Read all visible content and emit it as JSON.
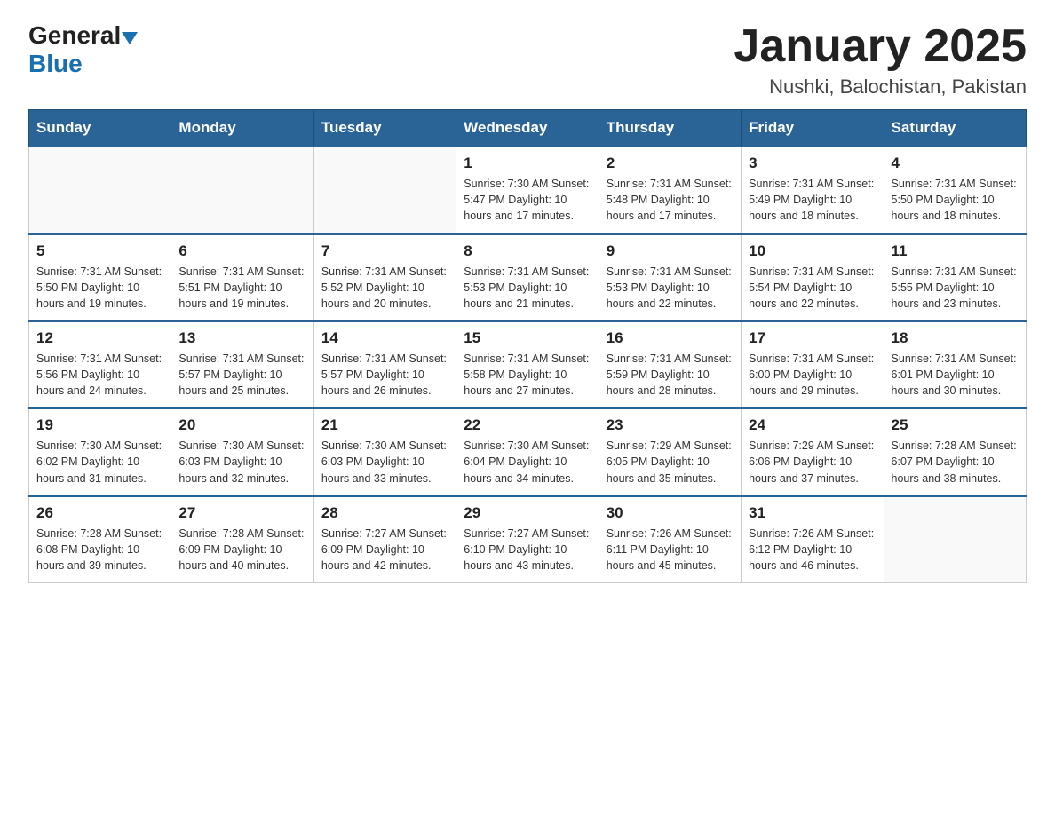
{
  "header": {
    "logo_general": "General",
    "logo_blue": "Blue",
    "title": "January 2025",
    "subtitle": "Nushki, Balochistan, Pakistan"
  },
  "weekdays": [
    "Sunday",
    "Monday",
    "Tuesday",
    "Wednesday",
    "Thursday",
    "Friday",
    "Saturday"
  ],
  "weeks": [
    [
      {
        "day": "",
        "info": ""
      },
      {
        "day": "",
        "info": ""
      },
      {
        "day": "",
        "info": ""
      },
      {
        "day": "1",
        "info": "Sunrise: 7:30 AM\nSunset: 5:47 PM\nDaylight: 10 hours\nand 17 minutes."
      },
      {
        "day": "2",
        "info": "Sunrise: 7:31 AM\nSunset: 5:48 PM\nDaylight: 10 hours\nand 17 minutes."
      },
      {
        "day": "3",
        "info": "Sunrise: 7:31 AM\nSunset: 5:49 PM\nDaylight: 10 hours\nand 18 minutes."
      },
      {
        "day": "4",
        "info": "Sunrise: 7:31 AM\nSunset: 5:50 PM\nDaylight: 10 hours\nand 18 minutes."
      }
    ],
    [
      {
        "day": "5",
        "info": "Sunrise: 7:31 AM\nSunset: 5:50 PM\nDaylight: 10 hours\nand 19 minutes."
      },
      {
        "day": "6",
        "info": "Sunrise: 7:31 AM\nSunset: 5:51 PM\nDaylight: 10 hours\nand 19 minutes."
      },
      {
        "day": "7",
        "info": "Sunrise: 7:31 AM\nSunset: 5:52 PM\nDaylight: 10 hours\nand 20 minutes."
      },
      {
        "day": "8",
        "info": "Sunrise: 7:31 AM\nSunset: 5:53 PM\nDaylight: 10 hours\nand 21 minutes."
      },
      {
        "day": "9",
        "info": "Sunrise: 7:31 AM\nSunset: 5:53 PM\nDaylight: 10 hours\nand 22 minutes."
      },
      {
        "day": "10",
        "info": "Sunrise: 7:31 AM\nSunset: 5:54 PM\nDaylight: 10 hours\nand 22 minutes."
      },
      {
        "day": "11",
        "info": "Sunrise: 7:31 AM\nSunset: 5:55 PM\nDaylight: 10 hours\nand 23 minutes."
      }
    ],
    [
      {
        "day": "12",
        "info": "Sunrise: 7:31 AM\nSunset: 5:56 PM\nDaylight: 10 hours\nand 24 minutes."
      },
      {
        "day": "13",
        "info": "Sunrise: 7:31 AM\nSunset: 5:57 PM\nDaylight: 10 hours\nand 25 minutes."
      },
      {
        "day": "14",
        "info": "Sunrise: 7:31 AM\nSunset: 5:57 PM\nDaylight: 10 hours\nand 26 minutes."
      },
      {
        "day": "15",
        "info": "Sunrise: 7:31 AM\nSunset: 5:58 PM\nDaylight: 10 hours\nand 27 minutes."
      },
      {
        "day": "16",
        "info": "Sunrise: 7:31 AM\nSunset: 5:59 PM\nDaylight: 10 hours\nand 28 minutes."
      },
      {
        "day": "17",
        "info": "Sunrise: 7:31 AM\nSunset: 6:00 PM\nDaylight: 10 hours\nand 29 minutes."
      },
      {
        "day": "18",
        "info": "Sunrise: 7:31 AM\nSunset: 6:01 PM\nDaylight: 10 hours\nand 30 minutes."
      }
    ],
    [
      {
        "day": "19",
        "info": "Sunrise: 7:30 AM\nSunset: 6:02 PM\nDaylight: 10 hours\nand 31 minutes."
      },
      {
        "day": "20",
        "info": "Sunrise: 7:30 AM\nSunset: 6:03 PM\nDaylight: 10 hours\nand 32 minutes."
      },
      {
        "day": "21",
        "info": "Sunrise: 7:30 AM\nSunset: 6:03 PM\nDaylight: 10 hours\nand 33 minutes."
      },
      {
        "day": "22",
        "info": "Sunrise: 7:30 AM\nSunset: 6:04 PM\nDaylight: 10 hours\nand 34 minutes."
      },
      {
        "day": "23",
        "info": "Sunrise: 7:29 AM\nSunset: 6:05 PM\nDaylight: 10 hours\nand 35 minutes."
      },
      {
        "day": "24",
        "info": "Sunrise: 7:29 AM\nSunset: 6:06 PM\nDaylight: 10 hours\nand 37 minutes."
      },
      {
        "day": "25",
        "info": "Sunrise: 7:28 AM\nSunset: 6:07 PM\nDaylight: 10 hours\nand 38 minutes."
      }
    ],
    [
      {
        "day": "26",
        "info": "Sunrise: 7:28 AM\nSunset: 6:08 PM\nDaylight: 10 hours\nand 39 minutes."
      },
      {
        "day": "27",
        "info": "Sunrise: 7:28 AM\nSunset: 6:09 PM\nDaylight: 10 hours\nand 40 minutes."
      },
      {
        "day": "28",
        "info": "Sunrise: 7:27 AM\nSunset: 6:09 PM\nDaylight: 10 hours\nand 42 minutes."
      },
      {
        "day": "29",
        "info": "Sunrise: 7:27 AM\nSunset: 6:10 PM\nDaylight: 10 hours\nand 43 minutes."
      },
      {
        "day": "30",
        "info": "Sunrise: 7:26 AM\nSunset: 6:11 PM\nDaylight: 10 hours\nand 45 minutes."
      },
      {
        "day": "31",
        "info": "Sunrise: 7:26 AM\nSunset: 6:12 PM\nDaylight: 10 hours\nand 46 minutes."
      },
      {
        "day": "",
        "info": ""
      }
    ]
  ]
}
